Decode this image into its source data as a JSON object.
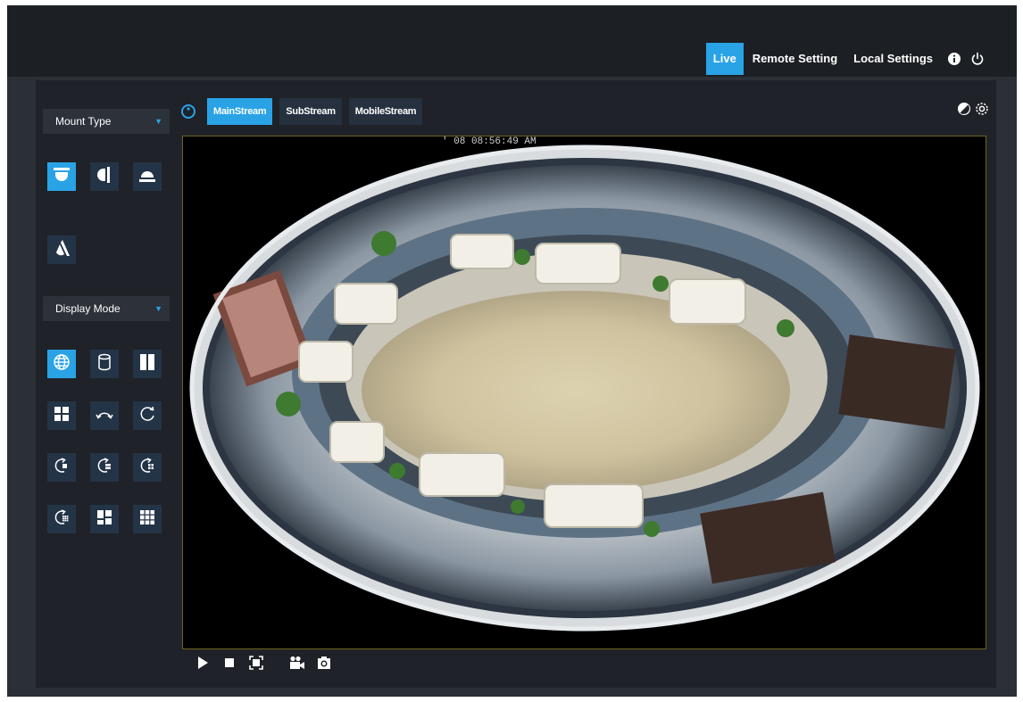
{
  "nav": {
    "items": [
      {
        "label": "Live",
        "active": true
      },
      {
        "label": "Remote Setting",
        "active": false
      },
      {
        "label": "Local Settings",
        "active": false
      }
    ],
    "info_icon": "info-icon",
    "power_icon": "power-icon"
  },
  "sidebar": {
    "mount_type": {
      "label": "Mount Type"
    },
    "mount_buttons": [
      "ceiling-mount-icon",
      "wall-mount-icon",
      "table-mount-icon",
      "tilted-mount-icon"
    ],
    "display_mode": {
      "label": "Display Mode"
    },
    "display_buttons": [
      "fisheye-globe-icon",
      "cylinder-icon",
      "dual-panorama-icon",
      "quad-view-icon",
      "arc-icon",
      "rotate-icon",
      "rotate-1p-icon",
      "rotate-2p-icon",
      "rotate-4p-icon",
      "rotate-9p-icon",
      "quad-split-icon",
      "grid-9-icon"
    ]
  },
  "streams": {
    "tabs": [
      {
        "label": "MainStream",
        "active": true
      },
      {
        "label": "SubStream",
        "active": false
      },
      {
        "label": "MobileStream",
        "active": false
      }
    ]
  },
  "video": {
    "osd_time": "' 08 08:56:49 AM"
  },
  "colors": {
    "accent": "#2aa3e6",
    "topbar": "#1c1f24",
    "panel": "#1f2228"
  }
}
